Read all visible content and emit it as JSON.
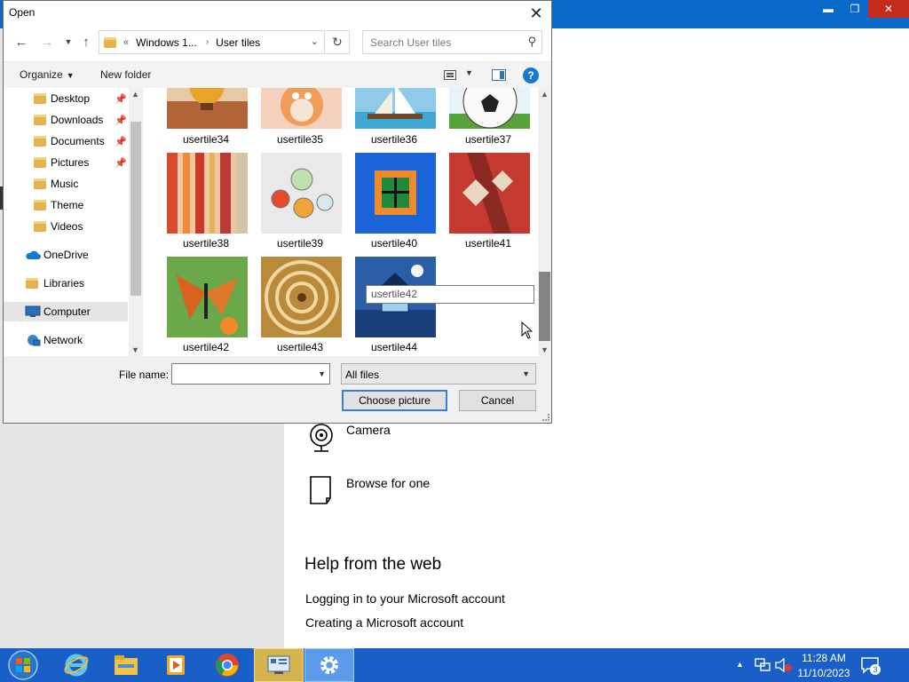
{
  "dialog": {
    "title": "Open",
    "address": {
      "crumbs": [
        "Windows 1...",
        "User tiles"
      ]
    },
    "search_placeholder": "Search User tiles",
    "toolbar": {
      "organize": "Organize",
      "new_folder": "New folder",
      "help": "?"
    },
    "nav_items": [
      {
        "label": "Desktop",
        "icon": "folder-desktop-icon",
        "pinned": true
      },
      {
        "label": "Downloads",
        "icon": "folder-downloads-icon",
        "pinned": true
      },
      {
        "label": "Documents",
        "icon": "folder-documents-icon",
        "pinned": true
      },
      {
        "label": "Pictures",
        "icon": "folder-pictures-icon",
        "pinned": true
      },
      {
        "label": "Music",
        "icon": "folder-music-icon",
        "pinned": false
      },
      {
        "label": "Theme",
        "icon": "folder-icon",
        "pinned": false
      },
      {
        "label": "Videos",
        "icon": "folder-videos-icon",
        "pinned": false
      },
      {
        "label": "OneDrive",
        "icon": "onedrive-icon",
        "pinned": false
      },
      {
        "label": "Libraries",
        "icon": "libraries-icon",
        "pinned": false
      },
      {
        "label": "Computer",
        "icon": "computer-icon",
        "pinned": false,
        "selected": true
      },
      {
        "label": "Network",
        "icon": "network-icon",
        "pinned": false
      }
    ],
    "files": [
      "usertile34",
      "usertile35",
      "usertile36",
      "usertile37",
      "usertile38",
      "usertile39",
      "usertile40",
      "usertile41",
      "usertile42",
      "usertile43",
      "usertile44"
    ],
    "rename_value": "usertile42",
    "file_name_label": "File name:",
    "file_name_value": "",
    "file_type_value": "All files",
    "choose_button": "Choose picture",
    "cancel_button": "Cancel"
  },
  "settings": {
    "options": [
      {
        "label": "Camera",
        "icon": "camera-icon"
      },
      {
        "label": "Browse for one",
        "icon": "file-icon"
      }
    ],
    "help_title": "Help from the web",
    "help_links": [
      "Logging in to your Microsoft account",
      "Creating a Microsoft account"
    ]
  },
  "taskbar": {
    "apps": [
      "internet-explorer-icon",
      "file-explorer-icon",
      "media-player-icon",
      "chrome-icon",
      "control-panel-icon",
      "settings-icon"
    ],
    "time": "11:28 AM",
    "date": "11/10/2023",
    "notification_count": "3"
  },
  "colors": {
    "accent": "#0a68c8",
    "taskbar": "#1a5fc7",
    "button_focus": "#3c7fd0"
  }
}
